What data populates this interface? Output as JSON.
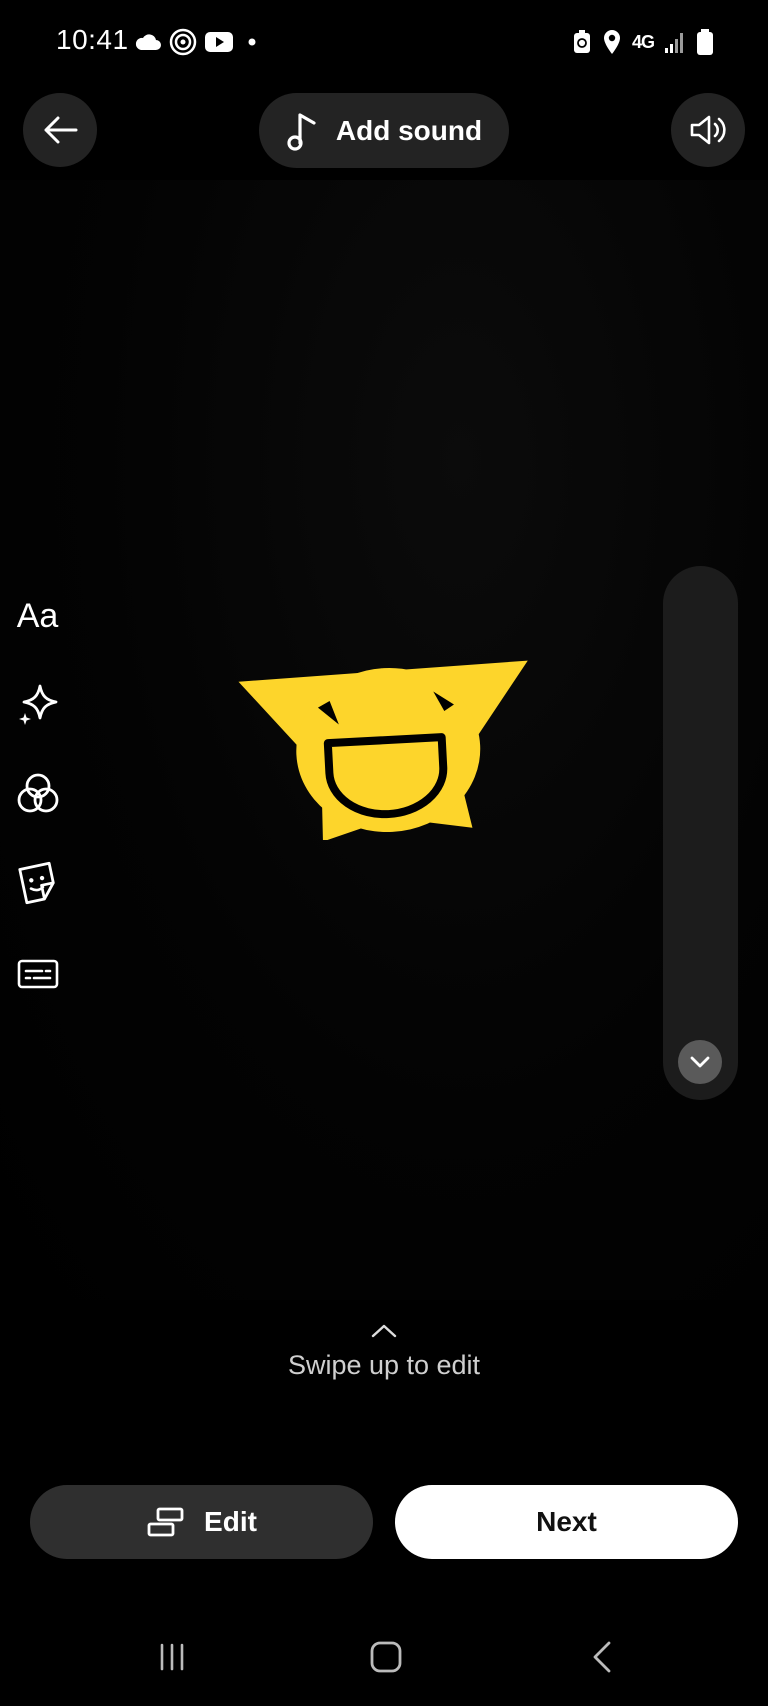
{
  "status_bar": {
    "time": "10:41",
    "network": "4G",
    "icons": [
      "cloud-icon",
      "threads-icon",
      "youtube-icon",
      "dot-icon",
      "battery-saver-icon",
      "location-icon",
      "signal-icon",
      "battery-icon"
    ]
  },
  "header": {
    "back_icon": "arrow-left-icon",
    "add_sound_label": "Add sound",
    "add_sound_icon": "music-note-icon",
    "volume_icon": "speaker-icon"
  },
  "media": {
    "sticker": "yellow-star-face-sticker",
    "sticker_color": "#FDD52B"
  },
  "tools": {
    "text_label": "Aa",
    "items": [
      "text-icon",
      "sparkle-effects-icon",
      "filters-icon",
      "sticker-icon",
      "captions-icon",
      "chevron-down-icon"
    ]
  },
  "swipe": {
    "label": "Swipe up to edit"
  },
  "actions": {
    "edit_label": "Edit",
    "next_label": "Next"
  },
  "nav": {
    "icons": [
      "recent-apps-icon",
      "home-icon",
      "back-icon"
    ]
  }
}
